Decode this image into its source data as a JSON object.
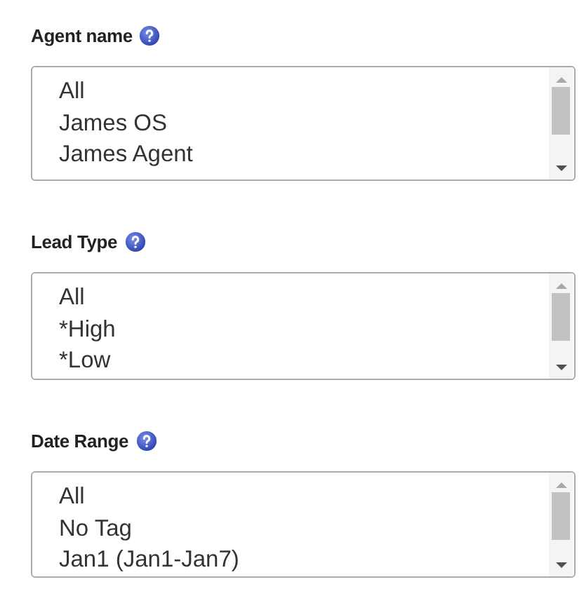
{
  "filters": [
    {
      "label": "Agent name",
      "options": [
        "All",
        "James OS",
        "James Agent"
      ]
    },
    {
      "label": "Lead Type",
      "options": [
        "All",
        "*High",
        "*Low"
      ]
    },
    {
      "label": "Date Range",
      "options": [
        "All",
        "No Tag",
        "Jan1 (Jan1-Jan7)"
      ]
    }
  ]
}
